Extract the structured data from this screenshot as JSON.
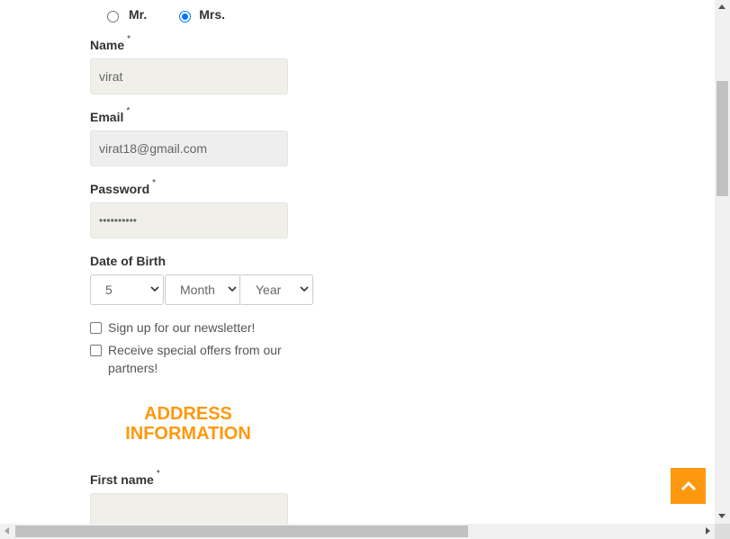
{
  "title_options": [
    {
      "label": "Mr.",
      "checked": false
    },
    {
      "label": "Mrs.",
      "checked": true
    }
  ],
  "required_marker": "*",
  "fields": {
    "name": {
      "label": "Name",
      "value": "virat"
    },
    "email": {
      "label": "Email",
      "value": "virat18@gmail.com"
    },
    "password": {
      "label": "Password",
      "value": "••••••••••"
    }
  },
  "dob": {
    "label": "Date of Birth",
    "day": "5",
    "month": "Month",
    "year": "Year"
  },
  "checkboxes": {
    "newsletter": {
      "label": "Sign up for our newsletter!",
      "checked": false
    },
    "offers": {
      "label": "Receive special offers from our partners!",
      "checked": false
    }
  },
  "address_section": {
    "heading": "ADDRESS INFORMATION",
    "first_name": {
      "label": "First name",
      "value": ""
    }
  },
  "icons": {
    "scroll_top": "chevron-up-icon"
  },
  "colors": {
    "accent": "#fe980f",
    "radio_checked": "#0075ff",
    "input_bg": "#f0f0e9"
  }
}
